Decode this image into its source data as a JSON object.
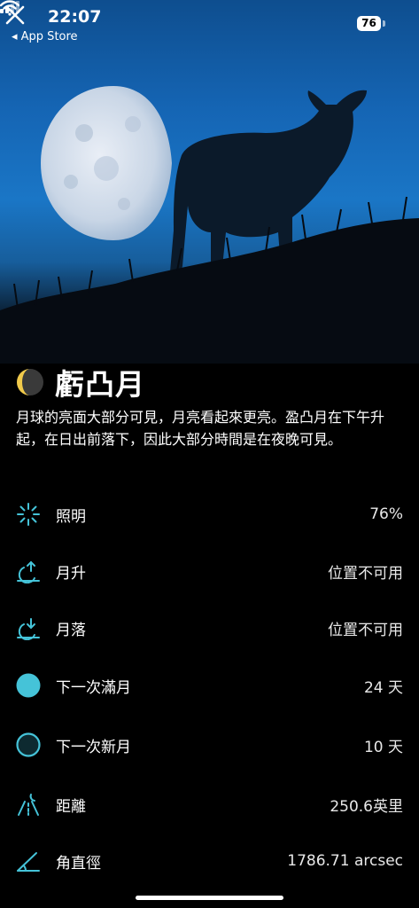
{
  "status_bar": {
    "time": "22:07",
    "back_app": "◂ App Store",
    "battery": "76"
  },
  "phase": {
    "name": "虧凸月",
    "description": "月球的亮面大部分可見，月亮看起來更亮。盈凸月在下午升起，在日出前落下，因此大部分時間是在夜晚可見。"
  },
  "details": [
    {
      "icon": "illumination-icon",
      "label": "照明",
      "value": "76%"
    },
    {
      "icon": "moonrise-icon",
      "label": "月升",
      "value": "位置不可用"
    },
    {
      "icon": "moonset-icon",
      "label": "月落",
      "value": "位置不可用"
    },
    {
      "icon": "full-moon-icon",
      "label": "下一次滿月",
      "value": "24 天"
    },
    {
      "icon": "new-moon-icon",
      "label": "下一次新月",
      "value": "10 天"
    },
    {
      "icon": "distance-icon",
      "label": "距離",
      "value": "250.6英里"
    },
    {
      "icon": "angle-icon",
      "label": "角直徑",
      "value": "1786.71 arcsec"
    }
  ],
  "colors": {
    "accent": "#45c3d8",
    "background": "#000000",
    "sky": "#1a76c6"
  }
}
